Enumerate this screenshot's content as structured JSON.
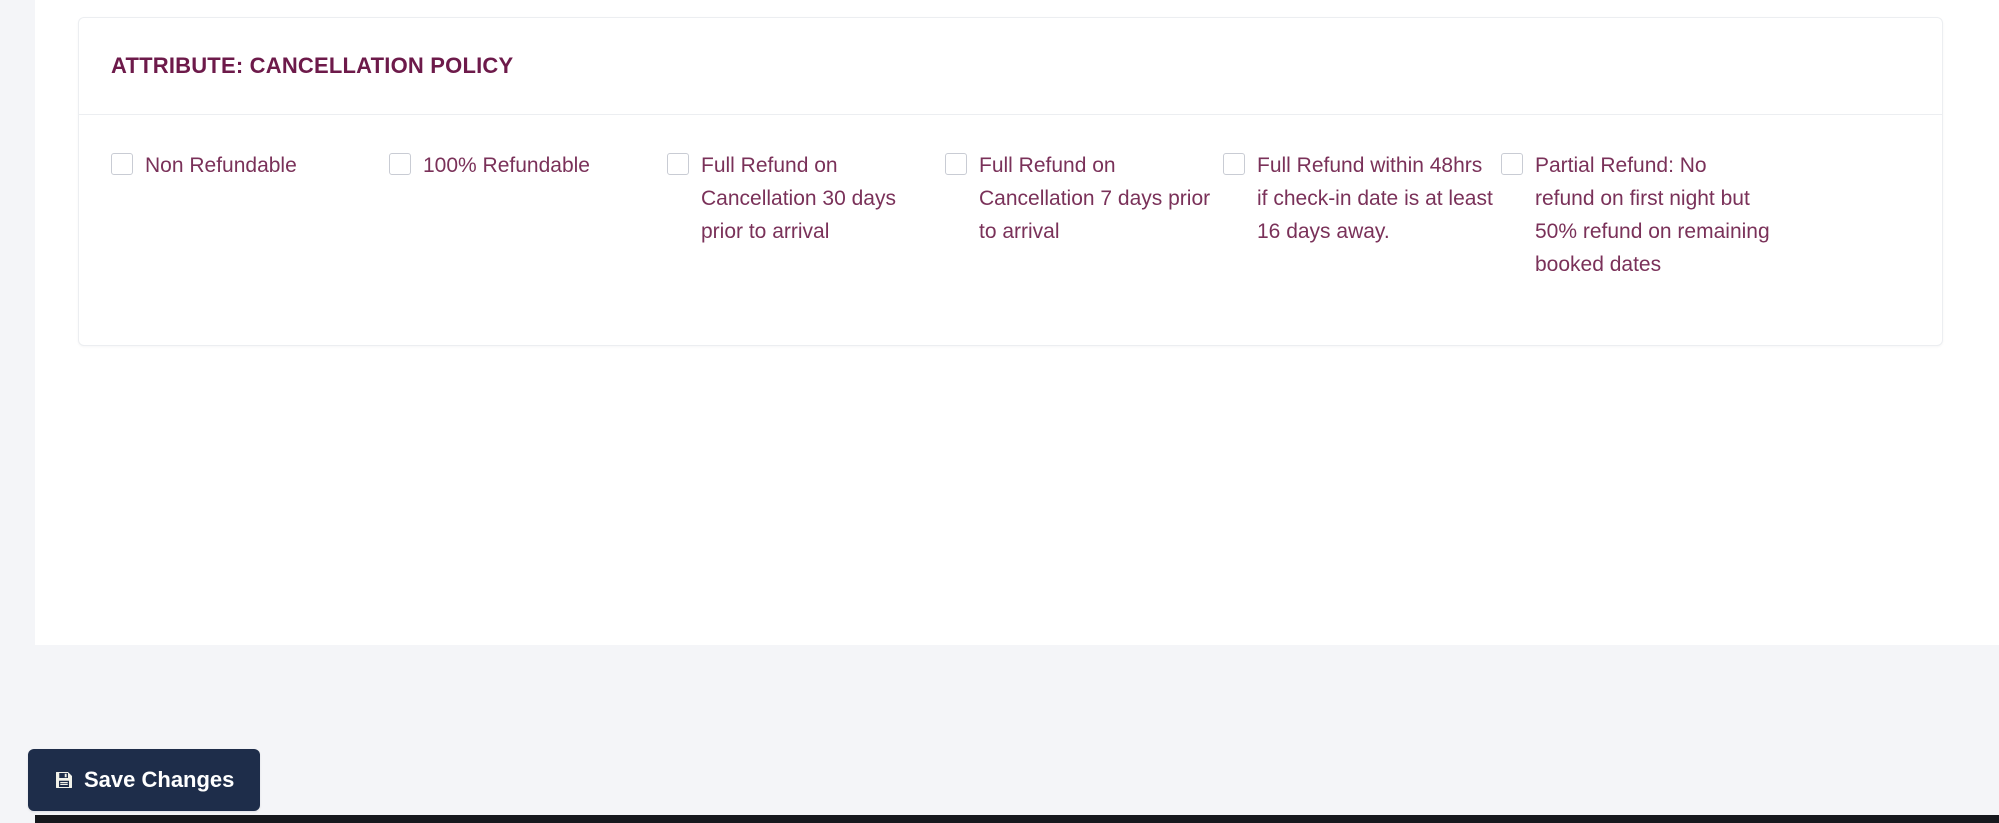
{
  "card": {
    "title": "ATTRIBUTE: CANCELLATION POLICY",
    "options": [
      {
        "label": "Non Refundable",
        "checked": false
      },
      {
        "label": "100% Refundable",
        "checked": false
      },
      {
        "label": "Full Refund on Cancellation 30 days prior to arrival",
        "checked": false
      },
      {
        "label": "Full Refund on Cancellation 7 days prior to arrival",
        "checked": false
      },
      {
        "label": "Full Refund within 48hrs if check-in date is at least 16 days away.",
        "checked": false
      },
      {
        "label": "Partial Refund: No refund on first night but 50% refund on remaining booked dates",
        "checked": false
      }
    ]
  },
  "footer": {
    "save_label": "Save Changes",
    "save_icon": "save-floppy-icon"
  },
  "colors": {
    "title": "#6d1a4a",
    "label": "#7a3159",
    "save_button_bg": "#1e2d4a",
    "page_bg": "#f4f5f8",
    "card_border": "#eceef1"
  }
}
